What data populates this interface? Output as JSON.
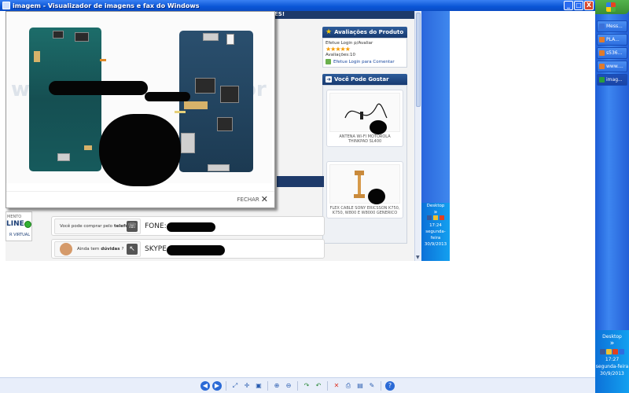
{
  "window": {
    "title": "imagem - Visualizador de imagens e fax do Windows",
    "buttons": {
      "minimize": "_",
      "maximize": "□",
      "close": "X"
    }
  },
  "taskbar": {
    "items": [
      {
        "label": "Mess...",
        "color": "#3b70d8"
      },
      {
        "label": "PLA...",
        "color": "#e07b2b"
      },
      {
        "label": "s536...",
        "color": "#e07b2b"
      },
      {
        "label": "www....",
        "color": "#e07b2b"
      },
      {
        "label": "imag...",
        "color": "#2a9d3a",
        "active": true
      }
    ],
    "tray": {
      "desktop": "Desktop",
      "time": "17:27",
      "day": "segunda-feira",
      "date": "30/9/2013"
    }
  },
  "screenshot_page": {
    "header_fragment": "ES!",
    "ratings_panel": {
      "title": "Avaliações do Produto",
      "login_text": "Efetue Login p/Avaliar",
      "ratings_count": "Avaliações:10",
      "comment_link": "Efetue Login para Comentar"
    },
    "suggest_panel": {
      "title": "Você Pode Gostar",
      "products": [
        {
          "name": "ANTENA WI-FI MOTOROLA THINKPAD SL400"
        },
        {
          "name": "FLEX CABLE SONY ERICSSON K750, K750, W800 E W8000 GENERICO"
        }
      ]
    },
    "online_badge": {
      "top": "MENTO",
      "main": "LINE",
      "bottom": "R VIRTUAL"
    },
    "contact": {
      "phone_prompt_pre": "Você pode comprar pelo",
      "phone_prompt_bold": "telefone",
      "phone_label": "FONE:",
      "doubts_pre": "Ainda tem",
      "doubts_bold": "dúvidas",
      "doubts_post": "?",
      "skype_label": "SKYPE"
    },
    "mini_tray": {
      "desktop": "Desktop",
      "time": "17:24",
      "day": "segunda-feira",
      "date": "30/9/2013"
    }
  },
  "popup": {
    "watermark_left": "www",
    "watermark_right": "or",
    "close_label": "FECHAR"
  },
  "toolbar": {
    "icons": [
      "prev-image-icon",
      "next-image-icon",
      "best-fit-icon",
      "actual-size-icon",
      "slideshow-icon",
      "zoom-in-icon",
      "zoom-out-icon",
      "rotate-cw-icon",
      "rotate-ccw-icon",
      "delete-icon",
      "print-icon",
      "save-icon",
      "edit-icon",
      "help-icon"
    ]
  }
}
